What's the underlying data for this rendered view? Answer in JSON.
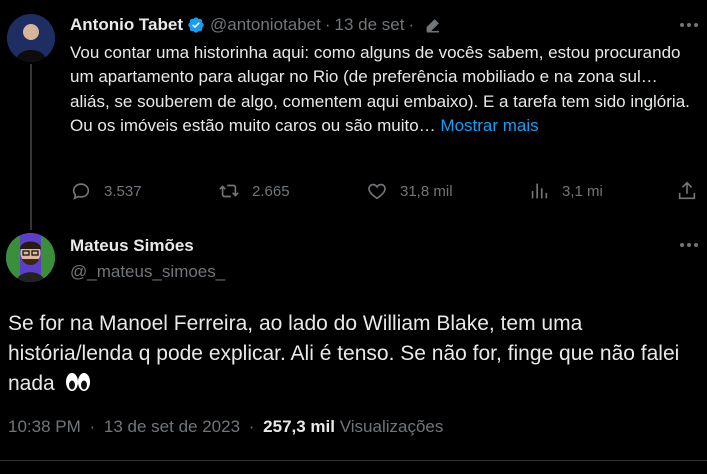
{
  "parent_tweet": {
    "author_name": "Antonio Tabet",
    "handle": "@antoniotabet",
    "separator": "·",
    "date": "13 de set",
    "text": "Vou contar uma historinha aqui: como alguns de vocês sabem, estou procurando um apartamento para alugar no Rio (de preferência mobiliado e na zona sul… aliás, se souberem de algo, comentem aqui embaixo). E a tarefa tem sido inglória. Ou os imóveis estão muito caros ou são muito…",
    "show_more": "Mostrar mais",
    "replies": "3.537",
    "retweets": "2.665",
    "likes": "31,8 mil",
    "views": "3,1 mi",
    "icons": [
      "verified-badge-icon",
      "edit-icon",
      "more-icon",
      "reply-icon",
      "retweet-icon",
      "like-icon",
      "views-icon",
      "share-icon"
    ]
  },
  "reply_tweet": {
    "author_name": "Mateus Simões",
    "handle": "@_mateus_simoes_",
    "text": "Se for na Manoel Ferreira, ao lado do William Blake, tem uma história/lenda q pode explicar. Ali é tenso. Se não for, finge que não falei nada",
    "emoji": "👀",
    "time": "10:38 PM",
    "dot": "·",
    "date": "13 de set de 2023",
    "views_count": "257,3 mil",
    "views_label": "Visualizações"
  },
  "colors": {
    "background": "#000000",
    "text": "#e7e9ea",
    "secondary": "#71767b",
    "link": "#1d9bf0",
    "verified": "#1d9bf0"
  }
}
